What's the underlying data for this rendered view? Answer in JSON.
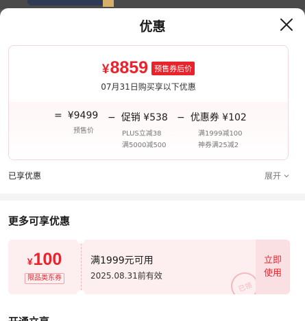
{
  "sheet": {
    "title": "优惠"
  },
  "price_card": {
    "currency_symbol": "¥",
    "final_price": "8859",
    "presale_badge": "预售券后价",
    "date_note": "07月31日购买享以下优惠",
    "breakdown": [
      {
        "operator": "=",
        "main": "¥9499",
        "sub": [
          "预售价"
        ]
      },
      {
        "operator": "−",
        "main": "促销 ¥538",
        "sub": [
          "PLUS立减38",
          "满5000减500"
        ]
      },
      {
        "operator": "−",
        "main": "优惠券 ¥102",
        "sub": [
          "满1999减100",
          "神券满25减2"
        ]
      }
    ]
  },
  "enjoyed": {
    "label": "已享优惠",
    "expand_label": "展开"
  },
  "more": {
    "title": "更多可享优惠"
  },
  "coupon": {
    "currency_symbol": "¥",
    "amount": "100",
    "tag": "限品类东券",
    "condition": "满1999元可用",
    "validity": "2025.08.31前有效",
    "action_line1": "立即",
    "action_line2": "使用",
    "stamp_text": "已领"
  },
  "next_section": {
    "title": "开通立享"
  },
  "colors": {
    "accent": "#e8232c",
    "coupon_bg": "#fdeff0",
    "divider": "#f4f4f4"
  },
  "icons": {
    "close": "close-icon",
    "expand": "chevron-down-icon"
  }
}
